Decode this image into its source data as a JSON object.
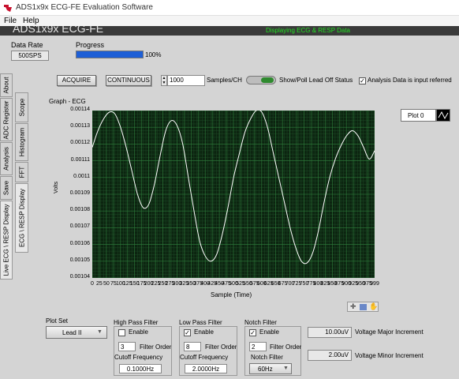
{
  "window": {
    "title": "ADS1x9x ECG-FE Evaluation Software"
  },
  "menu": {
    "file": "File",
    "help": "Help"
  },
  "banner": {
    "app_name": "ADS1x9x ECG-FE",
    "status": "Displaying ECG & RESP Data"
  },
  "top": {
    "data_rate_label": "Data Rate",
    "data_rate_value": "500SPS",
    "progress_label": "Progress",
    "progress_text": "100%",
    "progress_fraction": 1.0
  },
  "toolbar": {
    "acquire": "ACQUIRE",
    "continuous": "CONTINUOUS",
    "samples_value": "1000",
    "samples_label": "Samples/CH",
    "show_poll": "Show/Poll Lead Off Status",
    "analysis_label": "Analysis Data is input referred",
    "analysis_checked": "✓"
  },
  "side_tabs_outer": [
    "About",
    "ADC Register",
    "Analysis",
    "Save",
    "Live ECG \\ RESP Display"
  ],
  "side_tabs_inner": [
    "Scope",
    "Histogram",
    "FFT",
    "ECG \\ RESP Display"
  ],
  "graph": {
    "title": "Graph - ECG",
    "plot_legend": "Plot 0",
    "palette_icons": [
      "crosshair-icon",
      "zoom-icon",
      "pan-icon"
    ]
  },
  "chart_data": {
    "type": "line",
    "title": "Graph - ECG",
    "xlabel": "Sample (Time)",
    "ylabel": "Volts",
    "xlim": [
      0,
      999
    ],
    "ylim": [
      0.00104,
      0.00114
    ],
    "xticks": [
      "0",
      "25",
      "50",
      "75",
      "100",
      "125",
      "150",
      "175",
      "200",
      "225",
      "250",
      "275",
      "300",
      "325",
      "350",
      "375",
      "400",
      "425",
      "450",
      "475",
      "500",
      "525",
      "550",
      "575",
      "600",
      "625",
      "650",
      "675",
      "700",
      "725",
      "750",
      "775",
      "800",
      "825",
      "850",
      "875",
      "900",
      "925",
      "950",
      "975",
      "999"
    ],
    "yticks": [
      "0.00104",
      "0.00105",
      "0.00106",
      "0.00107",
      "0.00108",
      "0.00109",
      "0.0011",
      "0.00111",
      "0.00112",
      "0.00113",
      "0.00114"
    ],
    "series": [
      {
        "x": [
          0,
          20,
          40,
          60,
          80,
          100,
          120,
          140,
          160,
          180,
          200,
          220,
          240,
          260,
          280,
          300,
          320,
          340,
          360,
          380,
          400,
          420,
          440,
          460,
          480,
          500,
          520,
          540,
          560,
          580,
          600,
          620,
          640,
          660,
          680,
          700,
          720,
          740,
          760,
          780,
          800,
          820,
          840,
          860,
          880,
          900,
          920,
          940,
          960,
          980,
          999
        ],
        "values": [
          0.001118,
          0.001128,
          0.001135,
          0.001139,
          0.001138,
          0.00113,
          0.001118,
          0.001104,
          0.00109,
          0.001082,
          0.001084,
          0.001096,
          0.001113,
          0.001128,
          0.001134,
          0.001131,
          0.00112,
          0.0011,
          0.00108,
          0.001062,
          0.001053,
          0.00105,
          0.001054,
          0.001066,
          0.001082,
          0.0011,
          0.001114,
          0.001127,
          0.001135,
          0.00114,
          0.001139,
          0.00113,
          0.001115,
          0.0011,
          0.001085,
          0.00107,
          0.001058,
          0.00105,
          0.001049,
          0.001055,
          0.001068,
          0.001085,
          0.0011,
          0.001111,
          0.001119,
          0.001125,
          0.001128,
          0.001125,
          0.001118,
          0.001111,
          0.001116
        ]
      }
    ],
    "grid": true,
    "colors": {
      "line": "#ffffff",
      "background": "#0c2410",
      "grid": "#2d7a3a"
    }
  },
  "filters": {
    "plot_set_label": "Plot Set",
    "plot_set_value": "Lead II",
    "hpf": {
      "title": "High Pass Filter",
      "enable": "Enable",
      "enable_checked": "",
      "order_value": "3",
      "order_label": "Filter Order",
      "cutoff_label": "Cutoff Frequency",
      "cutoff_value": "0.1000Hz"
    },
    "lpf": {
      "title": "Low Pass Filter",
      "enable": "Enable",
      "enable_checked": "✓",
      "order_value": "8",
      "order_label": "Filter Order",
      "cutoff_label": "Cutoff Frequency",
      "cutoff_value": "2.0000Hz"
    },
    "notch": {
      "title": "Notch Filter",
      "enable": "Enable",
      "enable_checked": "✓",
      "order_value": "2",
      "order_label": "Filter Order",
      "notch_label": "Notch Filter",
      "notch_value": "60Hz"
    },
    "vmajor_value": "10.00uV",
    "vmajor_label": "Voltage Major Increment",
    "vminor_value": "2.00uV",
    "vminor_label": "Voltage Minor Increment"
  }
}
